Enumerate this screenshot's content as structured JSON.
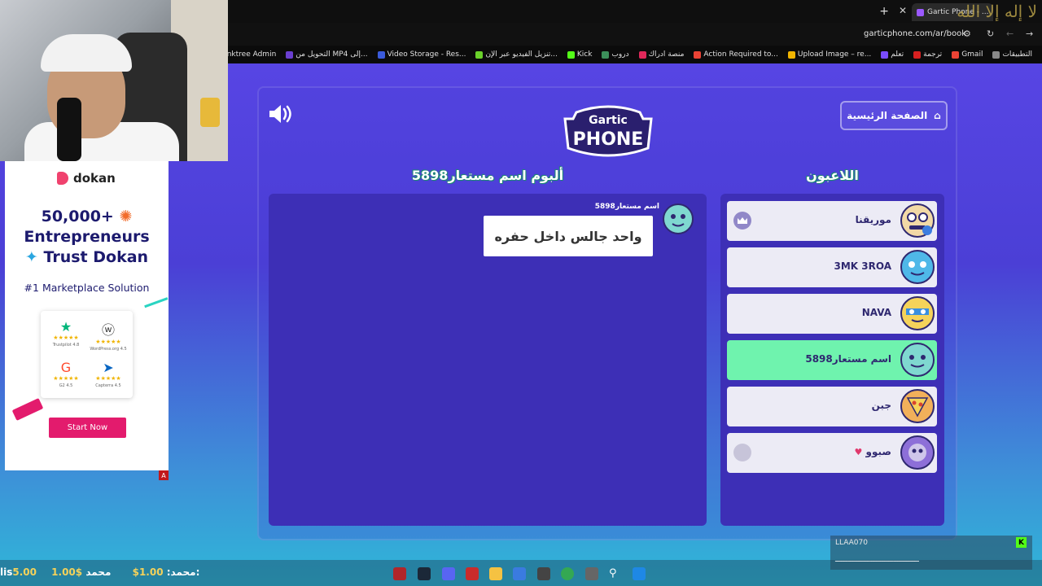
{
  "browser": {
    "tab_title": "Gartic Phone - ...",
    "url": "garticphone.com/ar/book",
    "corner_mark": "لا إله إلا الله",
    "bookmarks": [
      "التطبيقات",
      "Gmail",
      "ترجمة",
      "تعلم",
      "Upload Image – re...",
      "Action Required to...",
      "منصة ادراك",
      "دروب",
      "Kick",
      "تنزيل الفيديو عبر الإن...",
      "Video Storage - Res...",
      "التحويل من MP4 إلى...",
      "Linktree Admin"
    ]
  },
  "ad": {
    "brand": "dokan",
    "headline_line1": "50,000+",
    "headline_line2": "Entrepreneurs",
    "headline_line3": "Trust Dokan",
    "subline": "#1 Marketplace Solution",
    "ratings": [
      {
        "site": "Trustpilot 4.8",
        "icon": "trustpilot-icon"
      },
      {
        "site": "WordPress.org 4.5",
        "icon": "wordpress-icon"
      },
      {
        "site": "G2 4.5",
        "icon": "g2-icon"
      },
      {
        "site": "Capterra 4.5",
        "icon": "capterra-icon"
      }
    ],
    "cta": "Start Now",
    "badge": "A"
  },
  "game": {
    "logo_line1": "Gartic",
    "logo_line2": "PHONE",
    "home_button": "الصفحة الرئيسية",
    "album_title": "ألبوم اسم مستعار5898",
    "players_title": "اللاعبون",
    "message": {
      "author": "اسم مستعار5898",
      "text": "واحد جالس داخل حفره"
    },
    "players": [
      {
        "name": "موريقنا",
        "host": true,
        "active": false
      },
      {
        "name": "3MK 3ROA",
        "host": false,
        "active": false
      },
      {
        "name": "NAVA",
        "host": false,
        "active": false
      },
      {
        "name": "اسم مستعار5898",
        "host": false,
        "active": true
      },
      {
        "name": "جبن",
        "host": false,
        "active": false
      },
      {
        "name": "صبوو",
        "host": false,
        "active": false,
        "heart": "♥"
      }
    ]
  },
  "overlays": {
    "ticker_name1": "محمد:",
    "ticker_amount1": "1.00$",
    "ticker_name2": "محمد:",
    "ticker_amount2": "1.00$",
    "ticker_prefix": "lis",
    "ticker_amount3": "5.00",
    "kick_user": "LLAA070",
    "kick_message": "ـــــــــــــــــــــــــــــــــــــــ",
    "kick_badge": "K"
  },
  "colors": {
    "background_top": "#5b47e8",
    "background_bottom": "#2fb7d8",
    "panel_box": "#3d2fb6",
    "active_player": "#6ff3ae",
    "ad_accent": "#e31b6d",
    "title_outline": "#1d8b73"
  }
}
